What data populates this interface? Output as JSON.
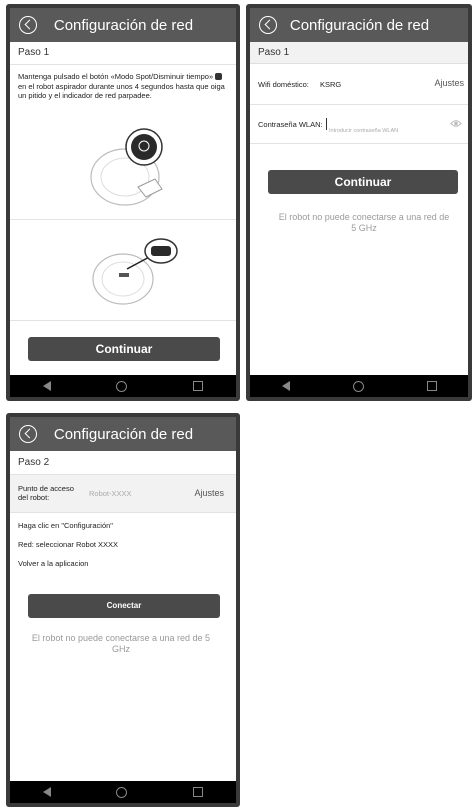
{
  "screens": [
    {
      "title": "Configuración de red",
      "step": "Paso 1",
      "instruction_part1": "Mantenga pulsado el botón «Modo Spot/Disminuir tiempo»",
      "instruction_part2": "en el robot aspirador durante unos 4 segundos hasta que oiga un pitido y el indicador de red parpadee.",
      "continue_label": "Continuar"
    },
    {
      "title": "Configuración de red",
      "step": "Paso 1",
      "wifi_label": "Wifi doméstico:",
      "wifi_value": "KSRG",
      "wifi_settings": "Ajustes",
      "password_label": "Contraseña WLAN:",
      "password_placeholder": "Introducir contraseña WLAN",
      "continue_label": "Continuar",
      "note": "El robot no puede conectarse a una red de 5 GHz"
    },
    {
      "title": "Configuración de red",
      "step": "Paso 2",
      "ap_label_line1": "Punto de acceso",
      "ap_label_line2": "del robot:",
      "ap_value": "Robot-XXXX",
      "ap_settings": "Ajustes",
      "instructions": [
        "Haga clic en \"Configuración\"",
        "Red: seleccionar Robot XXXX",
        "Volver a la aplicacion"
      ],
      "connect_label": "Conectar",
      "note": "El robot no puede conectarse a una red de 5 GHz"
    }
  ],
  "icons": [
    "back-icon",
    "eye-icon",
    "nav-back-icon",
    "nav-home-icon",
    "nav-recent-icon"
  ],
  "colors": {
    "header": "#595959",
    "button": "#4a4a4a",
    "navbar": "#000000",
    "note": "#9a9a9a"
  }
}
